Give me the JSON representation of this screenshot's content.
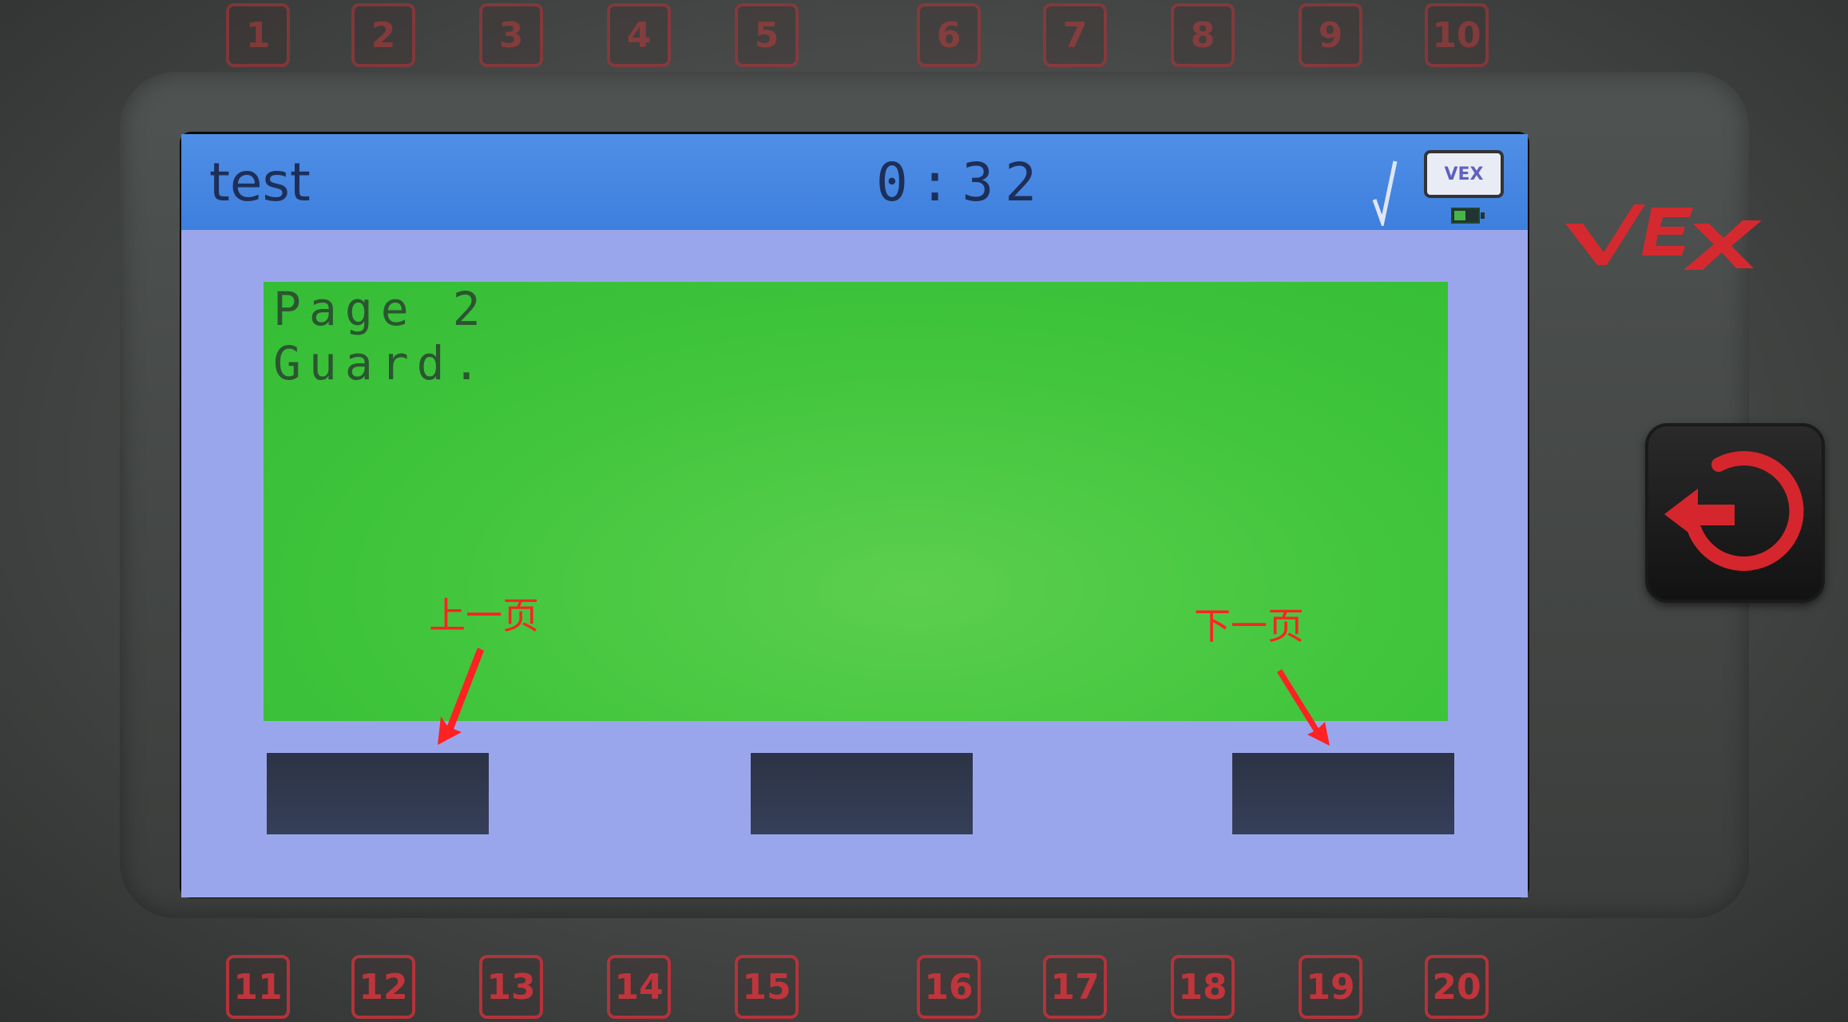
{
  "device": {
    "brand": "VEX",
    "ports_top": [
      "1",
      "2",
      "3",
      "4",
      "5",
      "6",
      "7",
      "8",
      "9",
      "10"
    ],
    "ports_bottom": [
      "11",
      "12",
      "13",
      "14",
      "15",
      "16",
      "17",
      "18",
      "19",
      "20"
    ]
  },
  "screen": {
    "program_name": "test",
    "timer": "0:32",
    "status_badge": "VEX",
    "content_lines": [
      "Page 2",
      "Guard."
    ],
    "buttons": [
      "",
      "",
      ""
    ]
  },
  "annotations": {
    "prev_page": "上一页",
    "next_page": "下一页"
  },
  "icons": {
    "back": "back-power-icon",
    "status_check": "checkmark-icon",
    "battery": "battery-icon"
  },
  "colors": {
    "titlebar": "#3e7fde",
    "content_bg": "#40c53c",
    "lcd_bg": "#9aa6ec",
    "button": "#2c3346",
    "annotation": "#ff2222",
    "port_outline": "#b3333a"
  }
}
